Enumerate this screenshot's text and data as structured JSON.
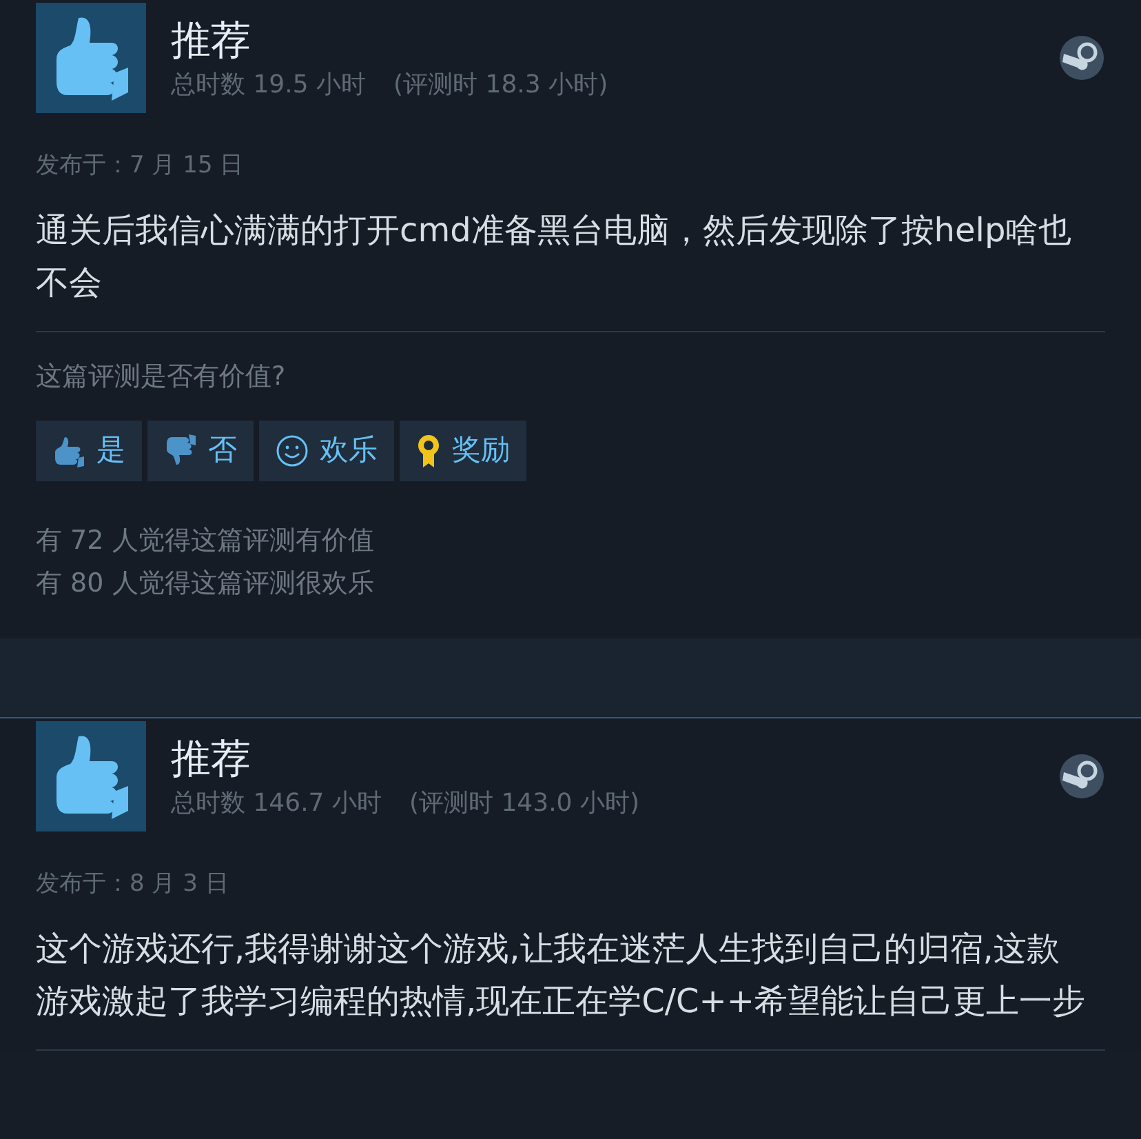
{
  "reviews": [
    {
      "verdict": {
        "kind": "recommended",
        "label": "推荐"
      },
      "total_hours": "总时数 19.5 小时",
      "review_hours": "(评测时 18.3 小时)",
      "posted": "发布于：7 月 15 日",
      "body": "通关后我信心满满的打开cmd准备黑台电脑，然后发现除了按help啥也不会",
      "feedback": {
        "question": "这篇评测是否有价值?",
        "buttons": [
          {
            "kind": "yes",
            "label": "是"
          },
          {
            "kind": "no",
            "label": "否"
          },
          {
            "kind": "funny",
            "label": "欢乐"
          },
          {
            "kind": "award",
            "label": "奖励"
          }
        ],
        "counts": [
          "有 72 人觉得这篇评测有价值",
          "有 80 人觉得这篇评测很欢乐"
        ]
      }
    },
    {
      "verdict": {
        "kind": "recommended",
        "label": "推荐"
      },
      "total_hours": "总时数 146.7 小时",
      "review_hours": "(评测时 143.0 小时)",
      "posted": "发布于：8 月 3 日",
      "body": "这个游戏还行,我得谢谢这个游戏,让我在迷茫人生找到自己的归宿,这款游戏激起了我学习编程的热情,现在正在学C/C++希望能让自己更上一步"
    }
  ]
}
